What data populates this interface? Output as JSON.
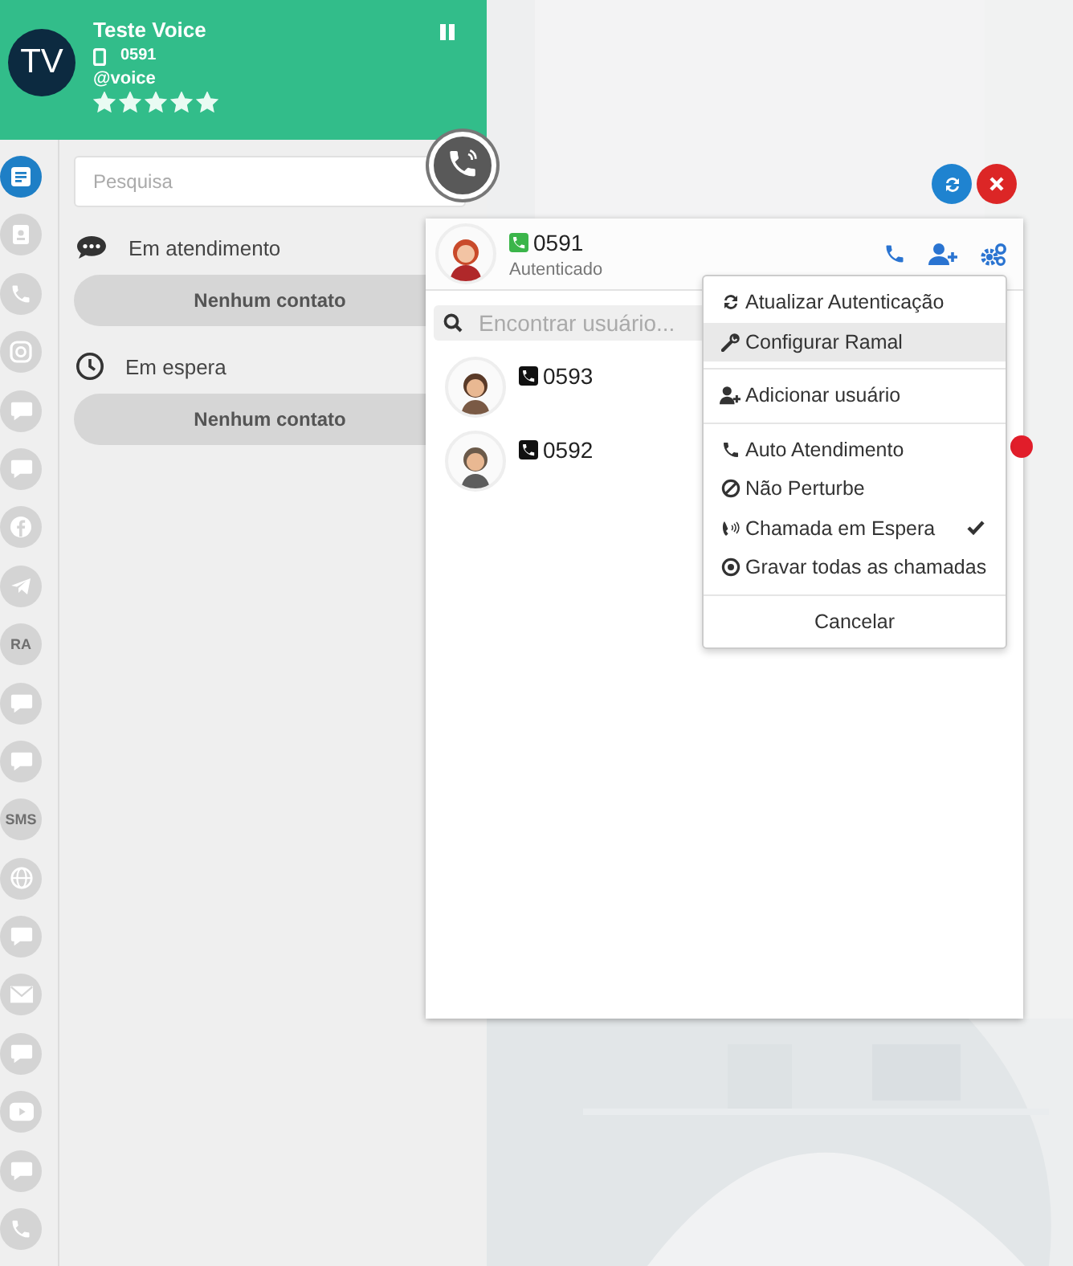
{
  "profile": {
    "initials": "TV",
    "name": "Teste Voice",
    "extension": "0591",
    "handle": "@voice",
    "stars": 5
  },
  "sidebar": {
    "items": [
      {
        "selected": true
      },
      {
        "selected": false
      },
      {
        "selected": false
      },
      {
        "selected": false
      },
      {
        "selected": false
      },
      {
        "selected": false
      },
      {
        "selected": false
      },
      {
        "selected": false
      },
      {
        "selected": false,
        "label": "RA"
      },
      {
        "selected": false
      },
      {
        "selected": false
      },
      {
        "selected": false,
        "label": "SMS"
      },
      {
        "selected": false
      },
      {
        "selected": false
      },
      {
        "selected": false
      },
      {
        "selected": false
      },
      {
        "selected": false
      },
      {
        "selected": false
      },
      {
        "selected": false
      }
    ]
  },
  "search": {
    "placeholder": "Pesquisa"
  },
  "sections": [
    {
      "title": "Em atendimento",
      "empty": "Nenhum contato"
    },
    {
      "title": "Em espera",
      "empty": "Nenhum contato"
    }
  ],
  "phone_panel": {
    "extension": "0591",
    "status": "Autenticado",
    "search_placeholder": "Encontrar usuário...",
    "users": [
      {
        "extension": "0593",
        "alert": false
      },
      {
        "extension": "0592",
        "alert": true
      }
    ]
  },
  "menu": {
    "groups": [
      [
        {
          "label": "Atualizar Autenticação",
          "highlighted": false,
          "checked": false
        },
        {
          "label": "Configurar Ramal",
          "highlighted": true,
          "checked": false
        }
      ],
      [
        {
          "label": "Adicionar usuário",
          "highlighted": false,
          "checked": false
        }
      ],
      [
        {
          "label": "Auto Atendimento",
          "highlighted": false,
          "checked": false
        },
        {
          "label": "Não Perturbe",
          "highlighted": false,
          "checked": false
        },
        {
          "label": "Chamada em Espera",
          "highlighted": false,
          "checked": true
        },
        {
          "label": "Gravar todas as chamadas",
          "highlighted": false,
          "checked": false
        }
      ]
    ],
    "cancel": "Cancelar"
  }
}
